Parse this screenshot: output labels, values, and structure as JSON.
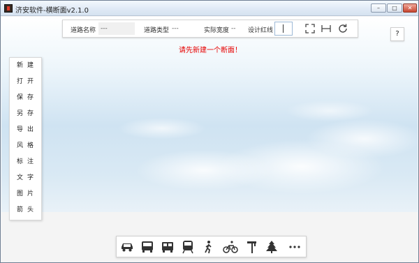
{
  "window": {
    "title": "济安软件-横断面v2.1.0",
    "controls": {
      "minimize": "–",
      "maximize": "□",
      "close": "✕"
    }
  },
  "infobar": {
    "road_name_label": "道路名称",
    "road_name_value": "---",
    "road_type_label": "道路类型",
    "road_type_value": "---",
    "actual_width_label": "实际宽度",
    "actual_width_value": "--",
    "design_redline_label": "设计红线",
    "tools": [
      "fullscreen-icon",
      "fit-width-icon",
      "refresh-icon"
    ]
  },
  "help": {
    "label": "?"
  },
  "notice": "请先新建一个断面！",
  "side_menu": {
    "items": [
      {
        "label": "新建"
      },
      {
        "label": "打开"
      },
      {
        "label": "保存"
      },
      {
        "label": "另存"
      },
      {
        "label": "导出"
      },
      {
        "label": "风格"
      },
      {
        "label": "标注"
      },
      {
        "label": "文字"
      },
      {
        "label": "图片"
      },
      {
        "label": "箭头"
      }
    ]
  },
  "bottom_toolbar": {
    "icons": [
      "car-icon",
      "bus-icon",
      "tram-icon",
      "train-icon",
      "pedestrian-icon",
      "bicycle-icon",
      "street-sign-icon",
      "tree-icon",
      "more-icon"
    ]
  },
  "colors": {
    "notice": "#e60000",
    "accent": "#9db9d6",
    "toolbar_icon": "#333333"
  }
}
